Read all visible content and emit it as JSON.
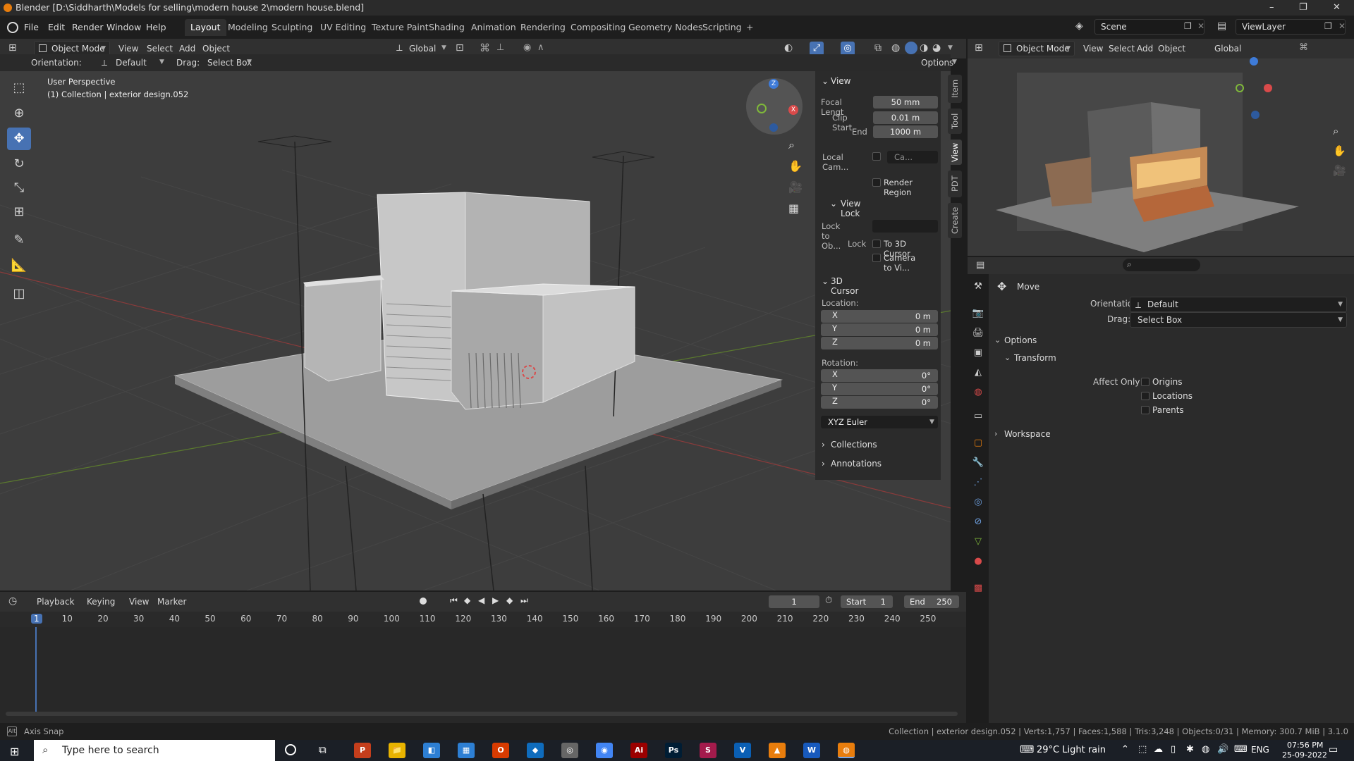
{
  "window": {
    "title": "Blender [D:\\Siddharth\\Models for selling\\modern house 2\\modern house.blend]",
    "minimize": "–",
    "restore": "❐",
    "close": "✕"
  },
  "menu": {
    "file": "File",
    "edit": "Edit",
    "render": "Render",
    "window": "Window",
    "help": "Help"
  },
  "workspace_tabs": [
    "Layout",
    "Modeling",
    "Sculpting",
    "UV Editing",
    "Texture Paint",
    "Shading",
    "Animation",
    "Rendering",
    "Compositing",
    "Geometry Nodes",
    "Scripting",
    "+"
  ],
  "scene": {
    "name": "Scene",
    "view_layer": "ViewLayer"
  },
  "viewport_header": {
    "mode": "Object Mode",
    "view": "View",
    "select": "Select",
    "add": "Add",
    "object": "Object",
    "transform_orientation": "Global"
  },
  "tool_settings": {
    "orientation_label": "Orientation:",
    "orientation_value": "Default",
    "drag_label": "Drag:",
    "drag_value": "Select Box",
    "options": "Options"
  },
  "overlay_text": {
    "perspective": "User Perspective",
    "collection": "(1) Collection | exterior design.052"
  },
  "gizmo": {
    "x": "X",
    "y": "Y",
    "z": "Z"
  },
  "npanel": {
    "view_title": "View",
    "focal_length_label": "Focal Lengt",
    "focal_length": "50 mm",
    "clip_start_label": "Clip Start",
    "clip_start": "0.01 m",
    "clip_end_label": "End",
    "clip_end": "1000 m",
    "local_camera_label": "Local Cam...",
    "local_camera_value": "Ca...",
    "render_region": "Render Region",
    "view_lock_title": "View Lock",
    "lock_to_object_label": "Lock to Ob...",
    "lock_label": "Lock",
    "to_3d_cursor": "To 3D Cursor",
    "camera_to_view": "Camera to Vi...",
    "cursor_title": "3D Cursor",
    "location_label": "Location:",
    "loc_x_label": "X",
    "loc_x": "0 m",
    "loc_y_label": "Y",
    "loc_y": "0 m",
    "loc_z_label": "Z",
    "loc_z": "0 m",
    "rotation_label": "Rotation:",
    "rot_x_label": "X",
    "rot_x": "0°",
    "rot_y_label": "Y",
    "rot_y": "0°",
    "rot_z_label": "Z",
    "rot_z": "0°",
    "rotation_mode": "XYZ Euler",
    "collections": "Collections",
    "annotations": "Annotations",
    "tabs": [
      "Item",
      "Tool",
      "View",
      "PDT",
      "Create"
    ]
  },
  "timeline": {
    "playback": "Playback",
    "keying": "Keying",
    "view": "View",
    "marker": "Marker",
    "current_frame": "1",
    "start_label": "Start",
    "start": "1",
    "end_label": "End",
    "end": "250",
    "ticks": [
      "1",
      "10",
      "20",
      "30",
      "40",
      "50",
      "60",
      "70",
      "80",
      "90",
      "100",
      "110",
      "120",
      "130",
      "140",
      "150",
      "160",
      "170",
      "180",
      "190",
      "200",
      "210",
      "220",
      "230",
      "240",
      "250"
    ]
  },
  "right_viewport": {
    "mode": "Object Mode",
    "view": "View",
    "select": "Select",
    "add": "Add",
    "object": "Object",
    "orientation": "Global"
  },
  "properties": {
    "tool_name": "Move",
    "orientation_label": "Orientation",
    "orientation_value": "Default",
    "drag_label": "Drag:",
    "drag_value": "Select Box",
    "options": "Options",
    "transform": "Transform",
    "affect_only": "Affect Only",
    "origins": "Origins",
    "locations": "Locations",
    "parents": "Parents",
    "workspace": "Workspace"
  },
  "statusbar": {
    "left": "Axis Snap",
    "right": "Collection | exterior design.052 | Verts:1,757 | Faces:1,588 | Tris:3,248 | Objects:0/31 | Memory: 300.7 MiB | 3.1.0"
  },
  "taskbar": {
    "search_placeholder": "Type here to search",
    "weather": "29°C  Light rain",
    "lang": "ENG",
    "time": "07:56 PM",
    "date": "25-09-2022",
    "apps": [
      "P",
      "📁",
      "◧",
      "▦",
      "O",
      "◆",
      "◎",
      "◉",
      "Ai",
      "Ps",
      "S",
      "V",
      "▲",
      "W",
      "◍"
    ]
  },
  "colors": {
    "accent": "#4772b3",
    "x_axis": "#d94a4a",
    "y_axis": "#7fb83a",
    "z_axis": "#3e7bd8",
    "timeline_cursor": "#4772b3"
  }
}
